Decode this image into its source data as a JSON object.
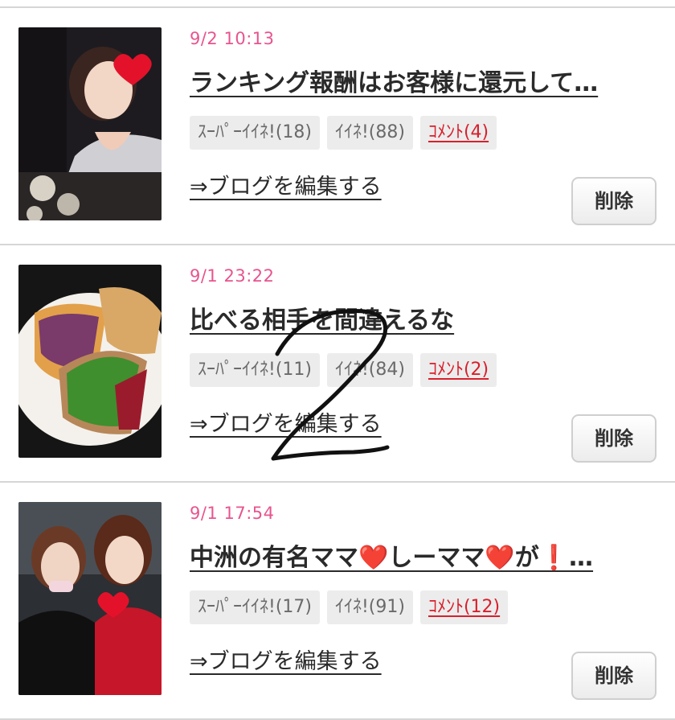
{
  "posts": [
    {
      "date": "9/2 10:13",
      "title": "ランキング報酬はお客様に還元して…",
      "super_like": "ｽｰﾊﾟｰｲｲﾈ!(18)",
      "like": "ｲｲﾈ!(88)",
      "comment": "ｺﾒﾝﾄ(4)",
      "edit_label": "⇒ブログを編集する",
      "delete_label": "削除",
      "thumbnail": "woman-selfie-heart-sticker"
    },
    {
      "date": "9/1 23:22",
      "title": "比べる相手を間違えるな",
      "super_like": "ｽｰﾊﾟｰｲｲﾈ!(11)",
      "like": "ｲｲﾈ!(84)",
      "comment": "ｺﾒﾝﾄ(2)",
      "edit_label": "⇒ブログを編集する",
      "delete_label": "削除",
      "thumbnail": "sandwich-on-plate"
    },
    {
      "date": "9/1 17:54",
      "title": "中洲の有名ママ❤️しーママ❤️が❗…",
      "super_like": "ｽｰﾊﾟｰｲｲﾈ!(17)",
      "like": "ｲｲﾈ!(91)",
      "comment": "ｺﾒﾝﾄ(12)",
      "edit_label": "⇒ブログを編集する",
      "delete_label": "削除",
      "thumbnail": "two-women-photo-heart-sticker"
    }
  ],
  "annotation": {
    "handwritten_mark": "2",
    "color": "#111111"
  },
  "colors": {
    "date": "#e8548e",
    "comment": "#d8202c",
    "badge_bg": "#ececec",
    "divider": "#d6d6d6"
  }
}
